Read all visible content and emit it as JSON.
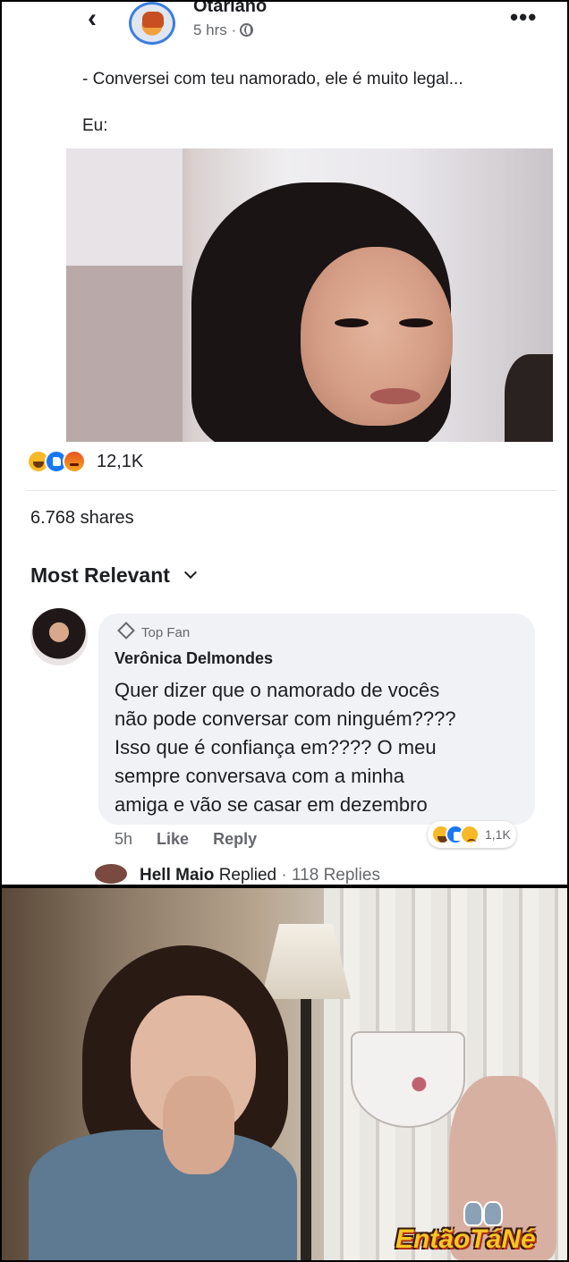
{
  "post": {
    "page_name": "Otariano",
    "time": "5 hrs ·",
    "back_icon": "chevron-left-icon",
    "more_icon": "more-dots-icon",
    "more_label": "•••",
    "back_label": "‹",
    "text_line1": "- Conversei com teu namorado, ele é muito legal...",
    "text_line2": "Eu:",
    "reaction_count": "12,1K",
    "shares": "6.768 shares"
  },
  "comments": {
    "sort_label": "Most Relevant",
    "items": [
      {
        "badge": "Top Fan",
        "author": "Verônica Delmondes",
        "text": "Quer dizer que o namorado de vocês\nnão pode conversar com ninguém????\nIsso que é confiança em???? O meu\nsempre  conversava com a minha\namiga e vão se casar em dezembro",
        "time": "5h",
        "like_label": "Like",
        "reply_label": "Reply",
        "reaction_count": "1,1K"
      }
    ],
    "reply_preview": {
      "name": "Hell Maio",
      "action": "Replied",
      "count": "· 118 Replies"
    }
  },
  "watermark": {
    "text": "EntãoTáNé"
  }
}
